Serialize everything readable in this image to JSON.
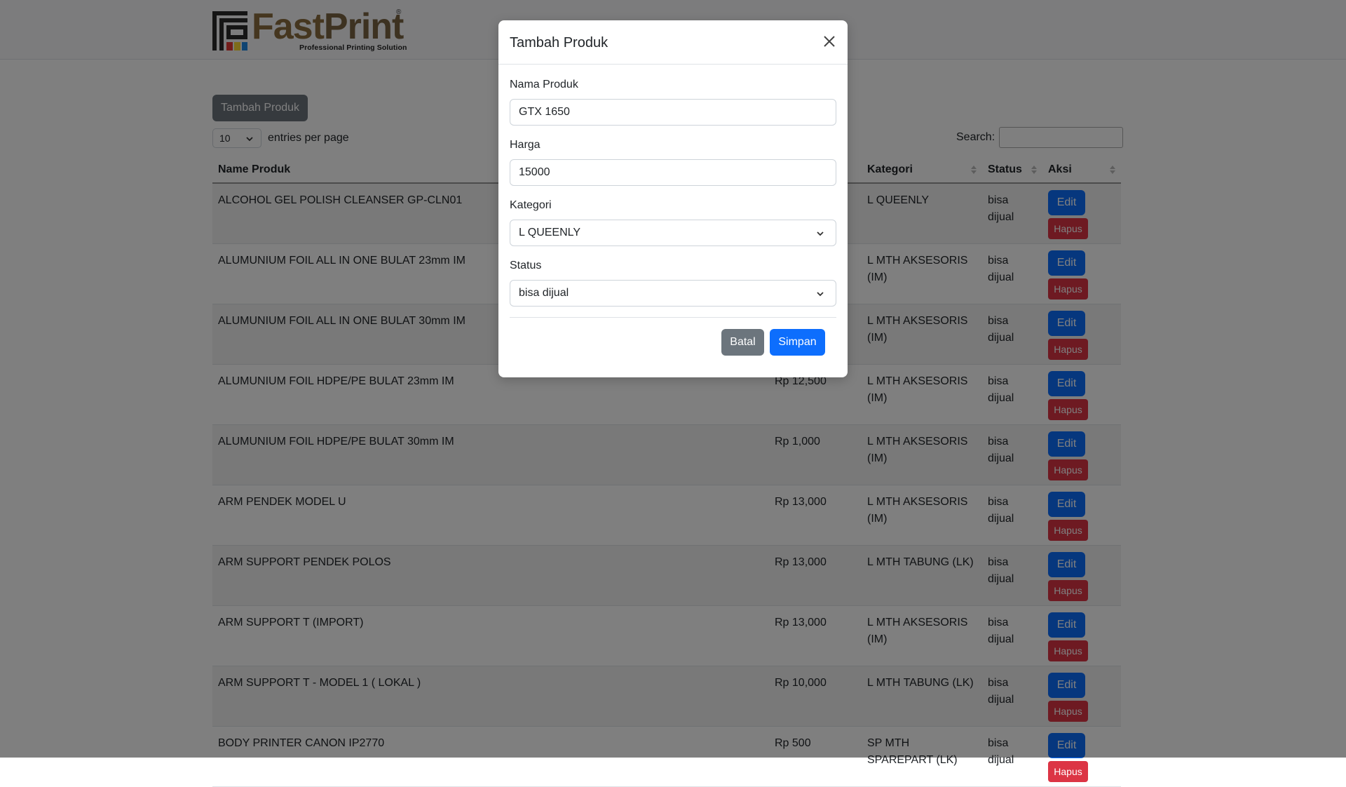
{
  "brand": {
    "name_part1": "Fast",
    "name_part2": "Print",
    "registered": "®",
    "tagline": "Professional Printing Solution"
  },
  "toolbar": {
    "add_button": "Tambah Produk",
    "entries_value": "10",
    "entries_label": "entries per page",
    "search_label": "Search:"
  },
  "table": {
    "headers": {
      "name": "Name Produk",
      "kategori": "Kategori",
      "status": "Status",
      "aksi": "Aksi"
    },
    "edit_label": "Edit",
    "hapus_label": "Hapus",
    "rows": [
      {
        "name": "ALCOHOL GEL POLISH CLEANSER GP-CLN01",
        "price": "",
        "kategori": "L QUEENLY",
        "status": "bisa dijual"
      },
      {
        "name": "ALUMUNIUM FOIL ALL IN ONE BULAT 23mm IM",
        "price": "",
        "kategori": "L MTH AKSESORIS (IM)",
        "status": "bisa dijual"
      },
      {
        "name": "ALUMUNIUM FOIL ALL IN ONE BULAT 30mm IM",
        "price": "",
        "kategori": "L MTH AKSESORIS (IM)",
        "status": "bisa dijual"
      },
      {
        "name": "ALUMUNIUM FOIL HDPE/PE BULAT 23mm IM",
        "price": "Rp 12,500",
        "kategori": "L MTH AKSESORIS (IM)",
        "status": "bisa dijual"
      },
      {
        "name": "ALUMUNIUM FOIL HDPE/PE BULAT 30mm IM",
        "price": "Rp 1,000",
        "kategori": "L MTH AKSESORIS (IM)",
        "status": "bisa dijual"
      },
      {
        "name": "ARM PENDEK MODEL U",
        "price": "Rp 13,000",
        "kategori": "L MTH AKSESORIS (IM)",
        "status": "bisa dijual"
      },
      {
        "name": "ARM SUPPORT PENDEK POLOS",
        "price": "Rp 13,000",
        "kategori": "L MTH TABUNG (LK)",
        "status": "bisa dijual"
      },
      {
        "name": "ARM SUPPORT T (IMPORT)",
        "price": "Rp 13,000",
        "kategori": "L MTH AKSESORIS (IM)",
        "status": "bisa dijual"
      },
      {
        "name": "ARM SUPPORT T - MODEL 1 ( LOKAL )",
        "price": "Rp 10,000",
        "kategori": "L MTH TABUNG (LK)",
        "status": "bisa dijual"
      },
      {
        "name": "BODY PRINTER CANON IP2770",
        "price": "Rp 500",
        "kategori": "SP MTH SPAREPART (LK)",
        "status": "bisa dijual"
      }
    ]
  },
  "modal": {
    "title": "Tambah Produk",
    "nama_label": "Nama Produk",
    "nama_value": "GTX 1650",
    "harga_label": "Harga",
    "harga_value": "15000",
    "kategori_label": "Kategori",
    "kategori_value": "L QUEENLY",
    "status_label": "Status",
    "status_value": "bisa dijual",
    "cancel_label": "Batal",
    "save_label": "Simpan"
  }
}
